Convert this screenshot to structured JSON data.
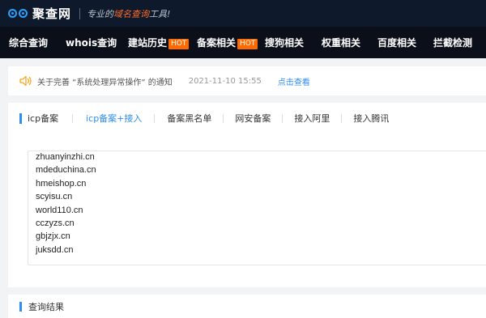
{
  "brand": {
    "name": "聚查网",
    "slogan_prefix": "专业的",
    "slogan_highlight": "域名查询",
    "slogan_suffix": "工具!"
  },
  "nav": {
    "items": [
      {
        "label": "综合查询",
        "hot": ""
      },
      {
        "label": "whois查询",
        "hot": ""
      },
      {
        "label": "建站历史",
        "hot": "HOT"
      },
      {
        "label": "备案相关",
        "hot": "HOT"
      },
      {
        "label": "搜狗相关",
        "hot": ""
      },
      {
        "label": "权重相关",
        "hot": ""
      },
      {
        "label": "百度相关",
        "hot": ""
      },
      {
        "label": "拦截检测",
        "hot": ""
      }
    ]
  },
  "notice": {
    "icon": "speaker-icon",
    "text": "关于完善 “系统处理异常操作” 的通知",
    "date": "2021-11-10 15:55",
    "link": "点击查看"
  },
  "tabs": {
    "items": [
      {
        "label": "icp备案",
        "active": false
      },
      {
        "label": "icp备案+接入",
        "active": true
      },
      {
        "label": "备案黑名单",
        "active": false
      },
      {
        "label": "网安备案",
        "active": false
      },
      {
        "label": "接入阿里",
        "active": false
      },
      {
        "label": "接入腾讯",
        "active": false
      }
    ]
  },
  "domains": [
    "zhuanyinzhi.cn",
    "mdeduchina.cn",
    "hmeishop.cn",
    "scyisu.cn",
    "world110.cn",
    "cczyzs.cn",
    "gbjzjx.cn",
    "juksdd.cn"
  ],
  "results": {
    "title": "查询结果"
  },
  "colors": {
    "accent": "#2e8df2",
    "hot": "#ff6a00",
    "topbar": "#0e1a2b",
    "nav": "#0b0f1a",
    "notice_icon": "#f5a623"
  }
}
